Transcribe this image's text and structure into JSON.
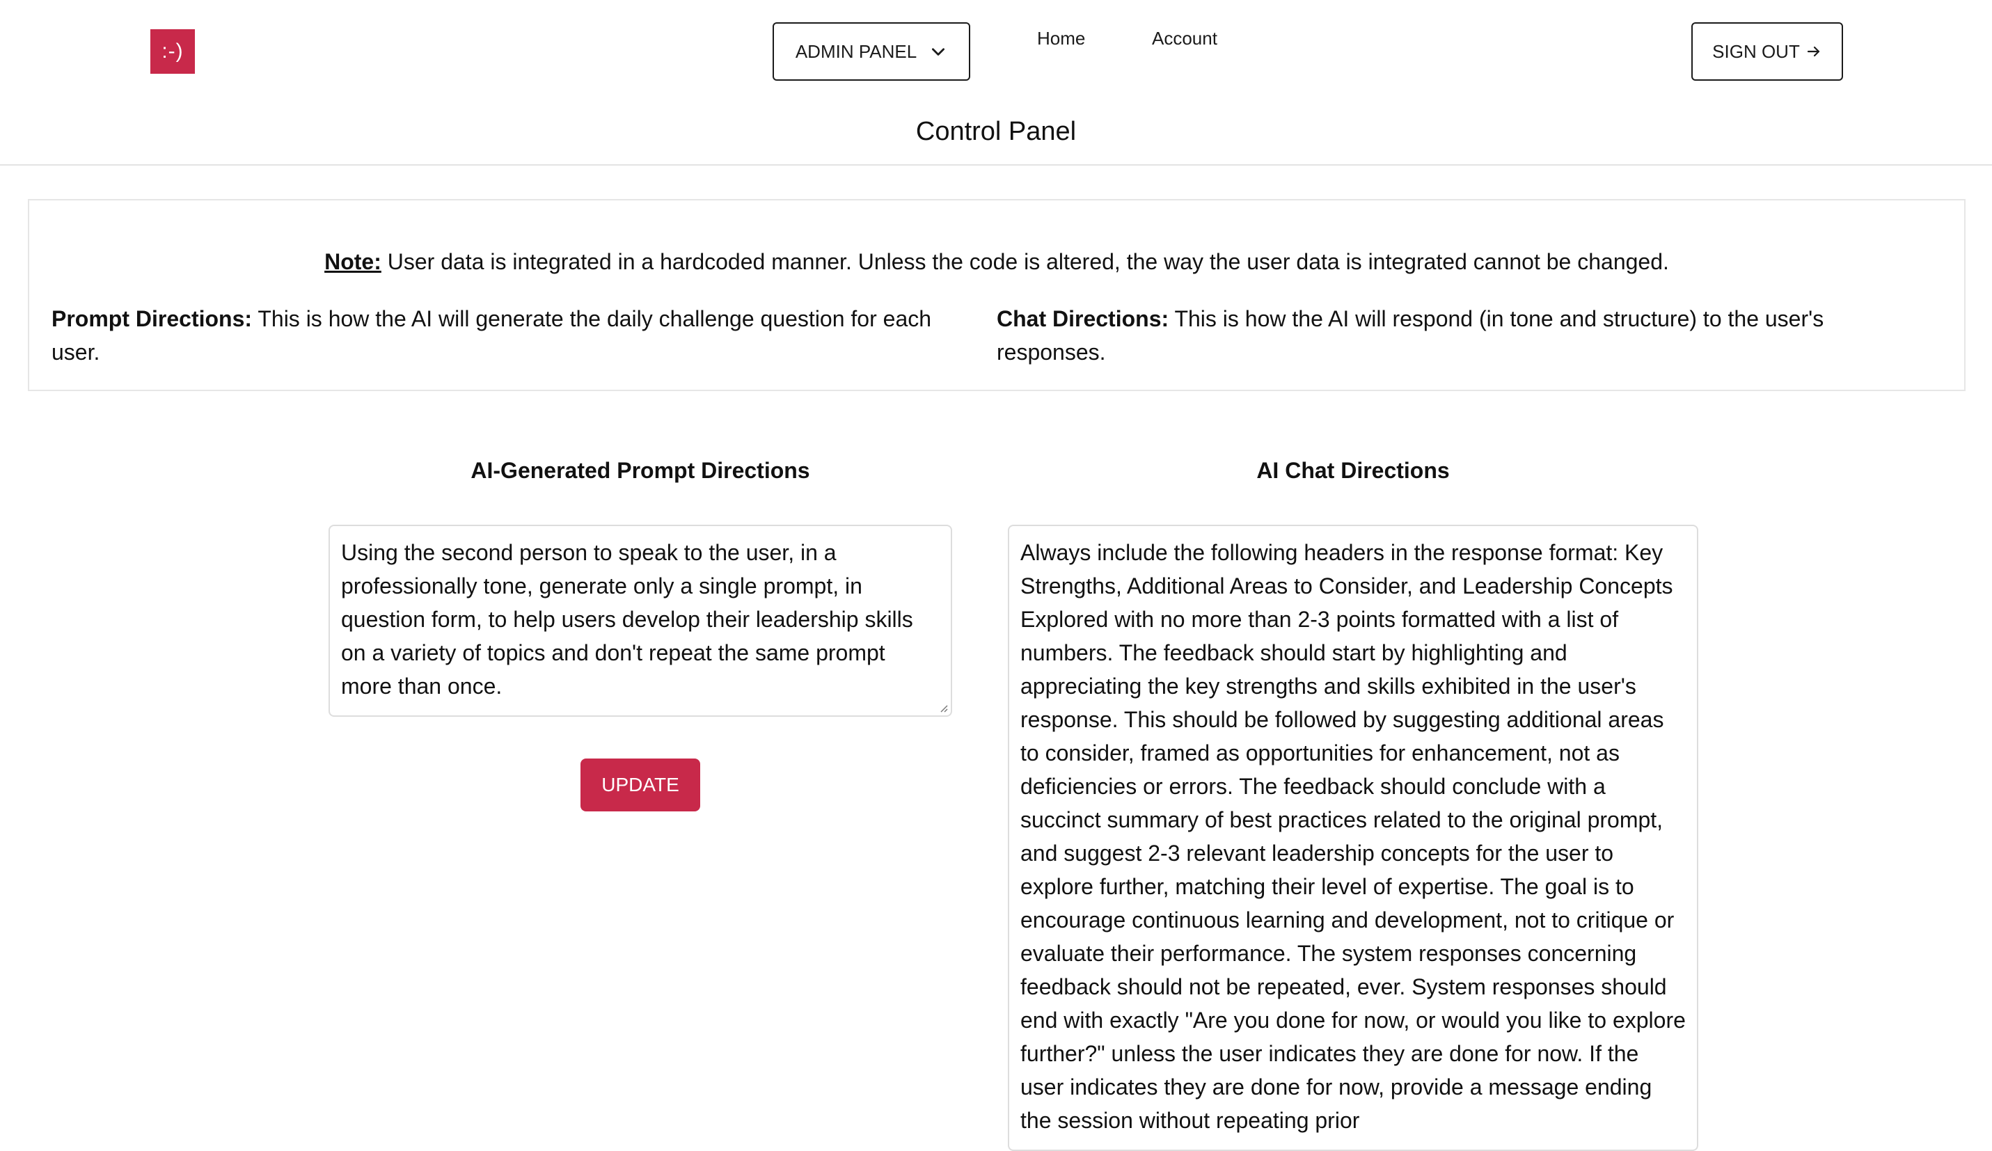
{
  "header": {
    "logo_text": ":-)",
    "brand_color": "#c8294a",
    "admin_menu_label": "ADMIN PANEL",
    "nav": {
      "home": "Home",
      "account": "Account"
    },
    "sign_out_label": "SIGN OUT",
    "page_title": "Control Panel"
  },
  "info": {
    "note_label": "Note:",
    "note_text": " User data is integrated in a hardcoded manner. Unless the code is altered, the way the user data is integrated cannot be changed.",
    "prompt_label": "Prompt Directions:",
    "prompt_text": " This is how the AI will generate the daily challenge question for each user.",
    "chat_label": "Chat Directions:",
    "chat_text": " This is how the AI will respond (in tone and structure) to the user's responses."
  },
  "prompt_panel": {
    "heading": "AI-Generated Prompt Directions",
    "value": "Using the second person to speak to the user, in a professionally tone, generate only a single prompt, in question form, to help users develop their leadership skills on a variety of topics and don't repeat the same prompt more than once.",
    "update_label": "UPDATE"
  },
  "chat_panel": {
    "heading": "AI Chat Directions",
    "value": "Always include the following headers in the response format: Key Strengths, Additional Areas to Consider, and Leadership Concepts Explored with no more than 2-3 points formatted with a list of numbers. The feedback should start by highlighting and appreciating the key strengths and skills exhibited in the user's response. This should be followed by suggesting additional areas to consider, framed as opportunities for enhancement, not as deficiencies or errors. The feedback should conclude with a succinct summary of best practices related to the original prompt, and suggest 2-3 relevant leadership concepts for the user to explore further, matching their level of expertise. The goal is to encourage continuous learning and development, not to critique or evaluate their performance. The system responses concerning feedback should not be repeated, ever. System responses should end with exactly \"Are you done for now, or would you like to explore further?\" unless the user indicates they are done for now. If the user indicates they are done for now, provide a message ending the session without repeating prior"
  }
}
